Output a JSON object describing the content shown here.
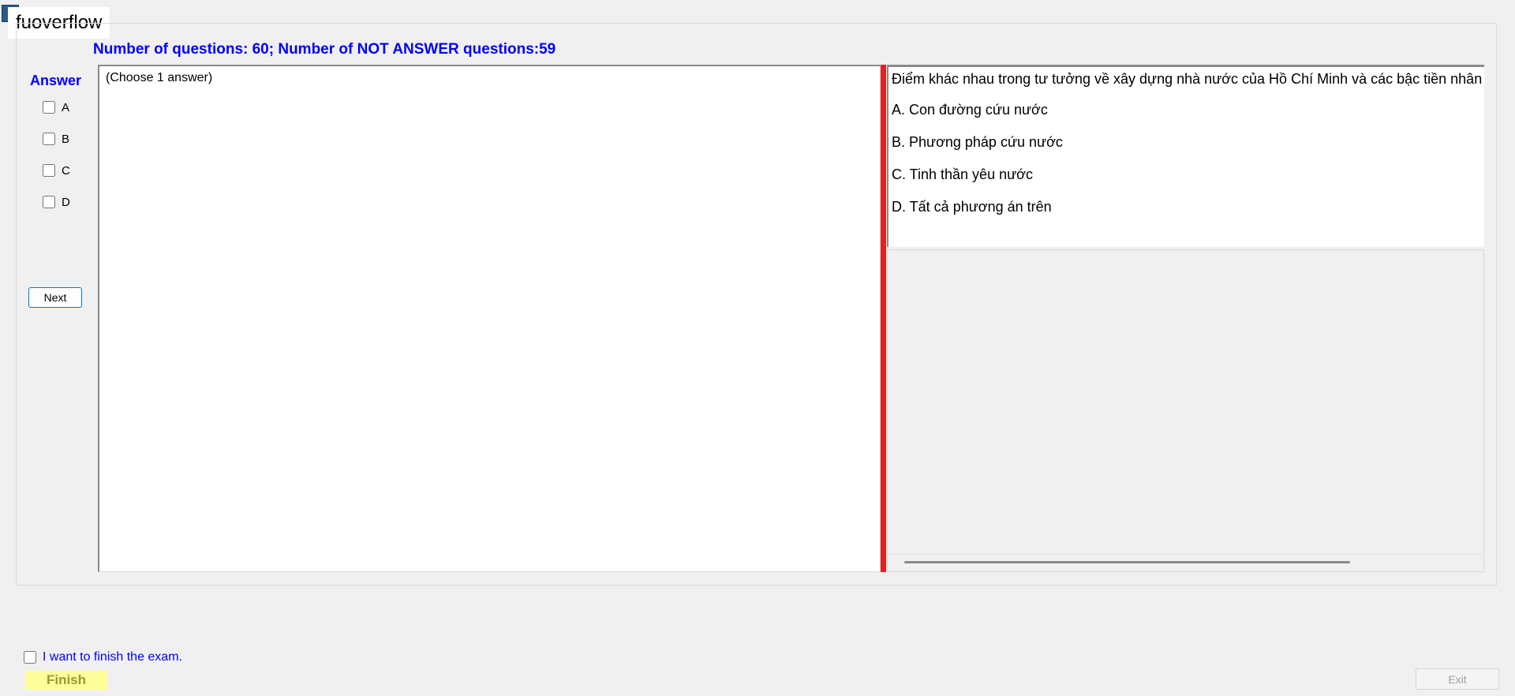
{
  "app": {
    "title": "fuoverflow"
  },
  "status": {
    "summary": "Number of questions: 60; Number of NOT ANSWER questions:59"
  },
  "answer_sidebar": {
    "heading": "Answer",
    "options": [
      "A",
      "B",
      "C",
      "D"
    ],
    "next_label": "Next"
  },
  "answer_panel": {
    "hint": "(Choose 1 answer)"
  },
  "question": {
    "text": "Điểm khác nhau trong tư tưởng về xây dựng nhà nước của Hồ Chí Minh và các bậc tiền nhân",
    "options": [
      "A.  Con đường cứu nước",
      "B.  Phương pháp cứu nước",
      "C.  Tinh thần yêu nước",
      "D.  Tất cả phương án trên"
    ]
  },
  "footer": {
    "finish_check_label": "I want to finish the exam.",
    "finish_label": "Finish",
    "exit_label": "Exit"
  },
  "colors": {
    "accent_blue": "#0000ff",
    "splitter_red": "#e62020",
    "finish_yellow": "#ffff99"
  }
}
